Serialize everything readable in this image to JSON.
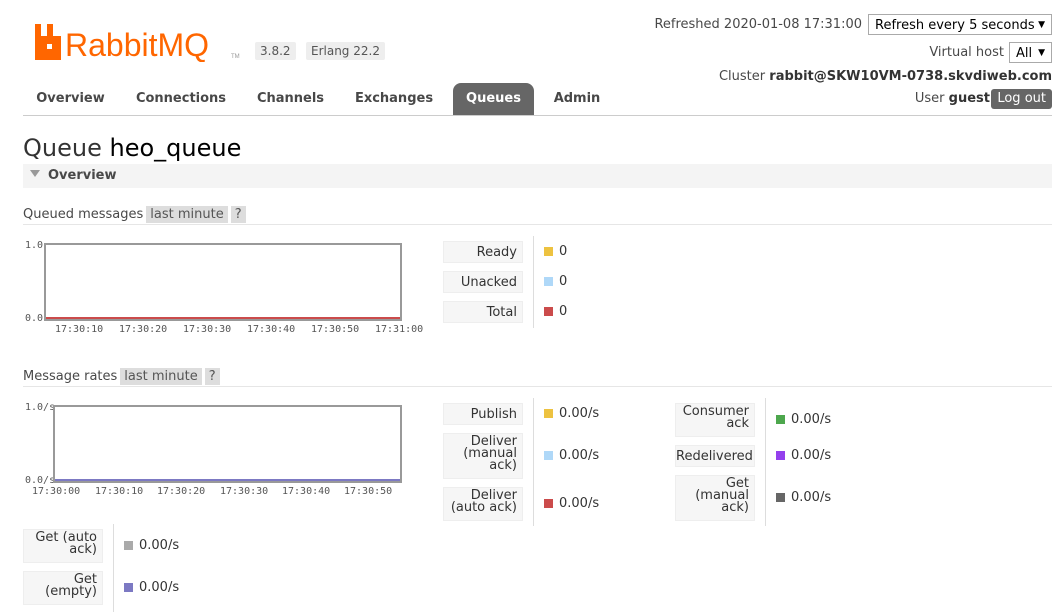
{
  "header": {
    "logo_text": "RabbitMQ",
    "logo_tm": "TM",
    "version": "3.8.2",
    "erlang": "Erlang 22.2",
    "refreshed_label": "Refreshed 2020-01-08 17:31:00",
    "refresh_select": "Refresh every 5 seconds",
    "vhost_label": "Virtual host",
    "vhost_select": "All",
    "cluster_label": "Cluster",
    "cluster_name": "rabbit@SKW10VM-0738.skvdiweb.com",
    "user_label": "User",
    "user_name": "guest",
    "logout_label": "Log out"
  },
  "tabs": [
    "Overview",
    "Connections",
    "Channels",
    "Exchanges",
    "Queues",
    "Admin"
  ],
  "active_tab": "Queues",
  "page": {
    "title_prefix": "Queue",
    "queue_name": "heo_queue",
    "section_label": "Overview"
  },
  "queued": {
    "heading": "Queued messages",
    "range": "last minute",
    "help": "?",
    "y_top": "1.0",
    "y_bottom": "0.0",
    "x_ticks": [
      "17:30:10",
      "17:30:20",
      "17:30:30",
      "17:30:40",
      "17:30:50",
      "17:31:00"
    ],
    "legend": [
      {
        "label": "Ready",
        "value": "0",
        "color": "#edc240"
      },
      {
        "label": "Unacked",
        "value": "0",
        "color": "#afd8f8"
      },
      {
        "label": "Total",
        "value": "0",
        "color": "#cb4b4b"
      }
    ]
  },
  "rates": {
    "heading": "Message rates",
    "range": "last minute",
    "help": "?",
    "y_top": "1.0/s",
    "y_bottom": "0.0/s",
    "x_ticks": [
      "17:30:00",
      "17:30:10",
      "17:30:20",
      "17:30:30",
      "17:30:40",
      "17:30:50"
    ],
    "col1": [
      {
        "label": "Publish",
        "value": "0.00/s",
        "color": "#edc240"
      },
      {
        "label": "Deliver (manual ack)",
        "value": "0.00/s",
        "color": "#afd8f8"
      },
      {
        "label": "Deliver (auto ack)",
        "value": "0.00/s",
        "color": "#cb4b4b"
      }
    ],
    "col2": [
      {
        "label": "Consumer ack",
        "value": "0.00/s",
        "color": "#4da74d"
      },
      {
        "label": "Redelivered",
        "value": "0.00/s",
        "color": "#9440ed"
      },
      {
        "label": "Get (manual ack)",
        "value": "0.00/s",
        "color": "#666666"
      }
    ],
    "col3": [
      {
        "label": "Get (auto ack)",
        "value": "0.00/s",
        "color": "#aaaaaa"
      },
      {
        "label": "Get (empty)",
        "value": "0.00/s",
        "color": "#7c79c3"
      }
    ]
  }
}
